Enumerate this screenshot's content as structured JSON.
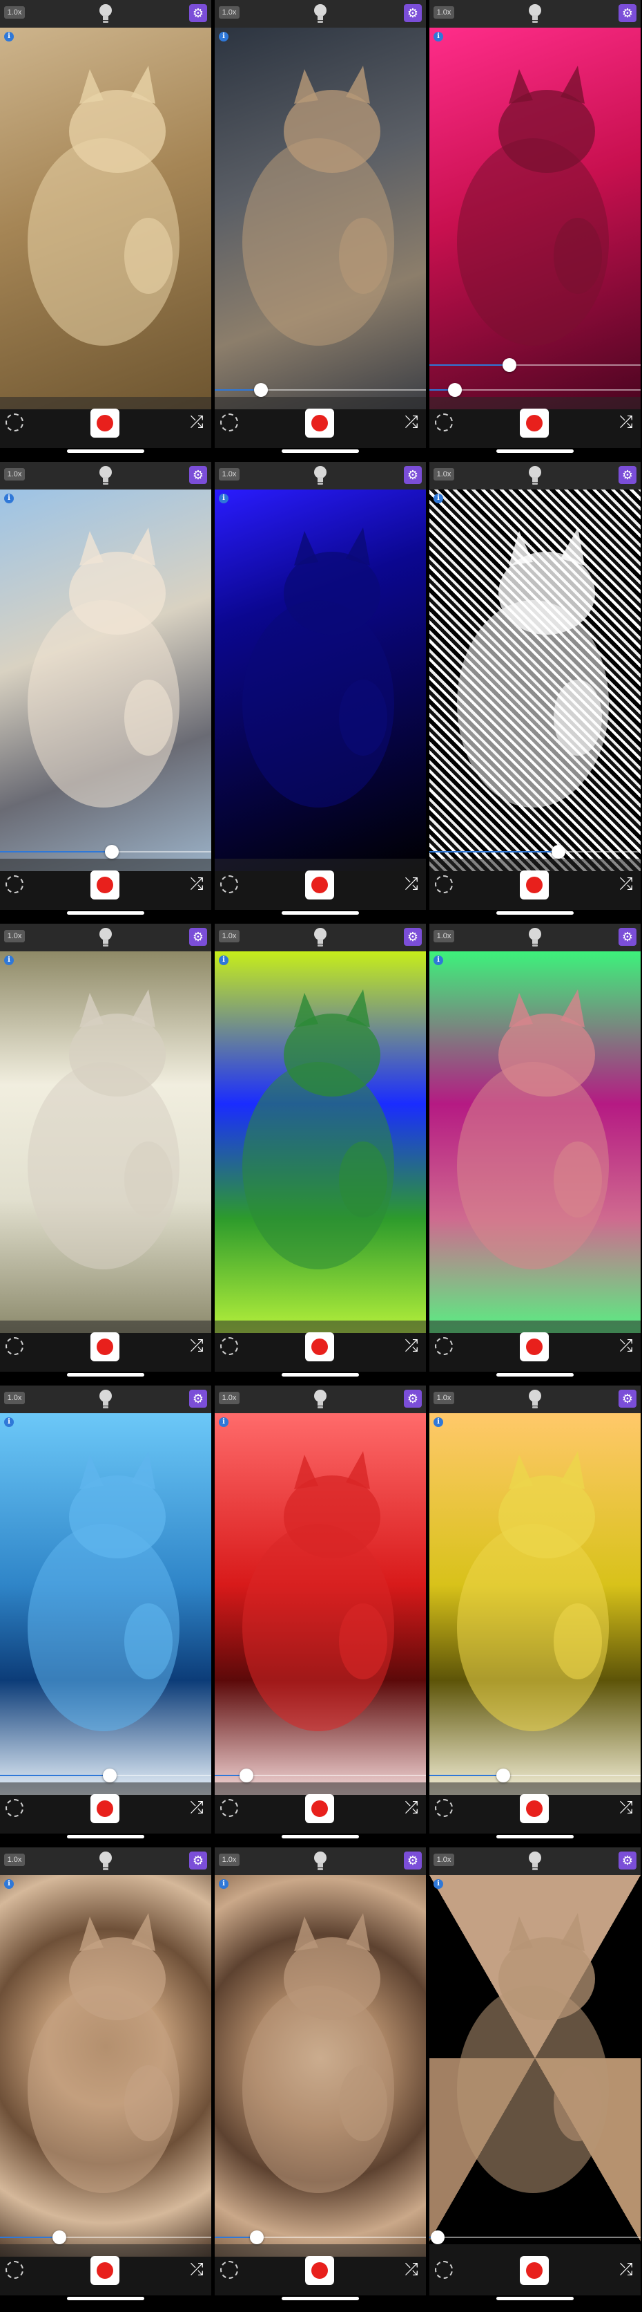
{
  "screens": [
    {
      "id": "sepia",
      "zoom": "1.0x",
      "bg": "linear-gradient(160deg,#cdb48c 0%,#a58555 45%,#6d5530 100%)",
      "cat": "#e9d3a8",
      "slider": null
    },
    {
      "id": "edges-color",
      "zoom": "1.0x",
      "bg": "linear-gradient(160deg,#2c3440 0%,#5b5f66 40%,#8c7e6b 70%,#3a3d44 100%)",
      "cat": "#b89a78",
      "slider": 0.22
    },
    {
      "id": "magenta",
      "zoom": "1.0x",
      "bg": "linear-gradient(160deg,#ff2d8a 0%,#c8104f 45%,#4a0520 100%)",
      "cat": "#7a1030",
      "slider": 0.12,
      "slider2": 0.38
    },
    {
      "id": "posterize",
      "zoom": "1.0x",
      "bg": "linear-gradient(160deg,#9cc3e6 0%,#d9d2c2 40%,#6a6b74 70%,#9cb3c9 100%)",
      "cat": "#f0e4d4",
      "slider": 0.53
    },
    {
      "id": "blue-dark",
      "zoom": "1.0x",
      "bg": "linear-gradient(160deg,#2a1cff 0%,#0b0790 30%,#05033d 70%,#000 100%)",
      "cat": "#0a0a78",
      "slider": null
    },
    {
      "id": "bw-edges",
      "zoom": "1.0x",
      "bg": "repeating-linear-gradient(45deg,#000 0 6px,#fff 6px 10px,#111 10px 15px,#eee 15px 19px)",
      "cat": "#ffffff",
      "slider": 0.61
    },
    {
      "id": "white-wash",
      "zoom": "1.0x",
      "bg": "linear-gradient(180deg,#8f8a67 0%,#f1eedf 35%,#e2e0cf 65%,#8c8a6c 100%)",
      "cat": "#d7d0c2",
      "slider": null
    },
    {
      "id": "neon-green",
      "zoom": "1.0x",
      "bg": "linear-gradient(180deg,#c7ee1a 0%,#1a2cff 40%,#2d9b2c 70%,#b5f03b 100%)",
      "cat": "#2c8a36",
      "slider": null
    },
    {
      "id": "magenta-green",
      "zoom": "1.0x",
      "bg": "linear-gradient(180deg,#3df27b 0%,#b51a83 40%,#cf6a8f 70%,#57f082 100%)",
      "cat": "#d7858c",
      "slider": null
    },
    {
      "id": "sky-blue",
      "zoom": "1.0x",
      "bg": "linear-gradient(180deg,#6cc8f8 0%,#2f85c8 45%,#0c3c78 70%,#eaf3fb 100%)",
      "cat": "#5fb5ee",
      "slider": 0.52
    },
    {
      "id": "red-tone",
      "zoom": "1.0x",
      "bg": "linear-gradient(180deg,#ff6b6b 0%,#d81a1a 45%,#5c0909 70%,#f5dada 100%)",
      "cat": "#d82626",
      "slider": 0.15
    },
    {
      "id": "yellow-tone",
      "zoom": "1.0x",
      "bg": "linear-gradient(180deg,#ffc86a 0%,#d8c21a 45%,#5d5408 70%,#f5f1da 100%)",
      "cat": "#ecd64b",
      "slider": 0.35
    },
    {
      "id": "kaleido-hex",
      "zoom": "1.0x",
      "bg": "radial-gradient(circle at 50% 45%,#a07a56 0%,#c29c78 25%,#6e5038 50%,#d5b89a 75%,#4a3424 100%)",
      "cat": "#c4a283",
      "slider": 0.28
    },
    {
      "id": "kaleido-quad",
      "zoom": "1.0x",
      "bg": "radial-gradient(circle at 50% 48%,#e0c6a7 0%,#a98464 30%,#5d4230 55%,#caa889 80%,#7e5f45 100%)",
      "cat": "#b9977a",
      "slider": 0.2
    },
    {
      "id": "kaleido-tri",
      "zoom": "1.0x",
      "bg": "conic-gradient(from 30deg at 50% 48%,#000 0 60deg,#b6926f 60deg 120deg,#000 120deg 180deg,#a28063 180deg 240deg,#000 240deg 300deg,#c4a184 300deg 360deg)",
      "cat": "#b79575",
      "slider": 0.04
    }
  ]
}
